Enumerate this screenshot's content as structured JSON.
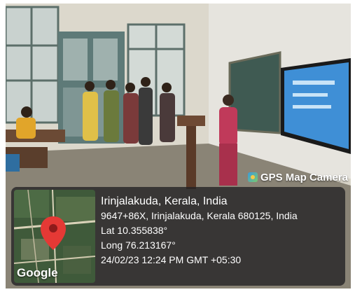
{
  "overlay": {
    "app_name": "GPS Map Camera",
    "map_logo": "Google",
    "map_pin_color": "#e53935",
    "location_title": "Irinjalakuda, Kerala, India",
    "address": "9647+86X, Irinjalakuda, Kerala 680125, India",
    "latitude": "Lat 10.355838°",
    "longitude": "Long 76.213167°",
    "datetime": "24/02/23 12:24 PM GMT +05:30"
  }
}
